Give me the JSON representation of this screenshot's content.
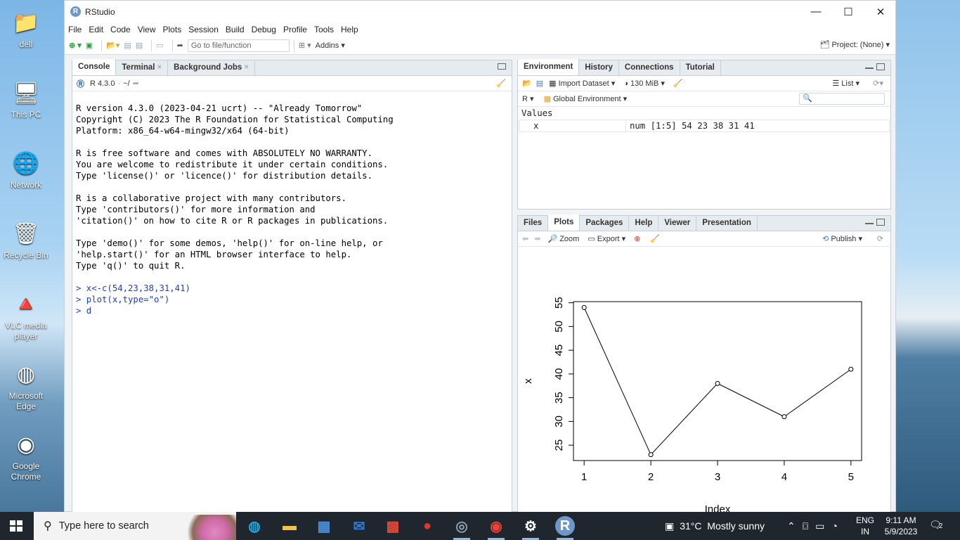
{
  "desktop": {
    "icons": [
      {
        "label": "dell",
        "icon": "user-folder-icon"
      },
      {
        "label": "This PC",
        "icon": "computer-icon"
      },
      {
        "label": "Network",
        "icon": "network-icon"
      },
      {
        "label": "Recycle Bin",
        "icon": "recycle-bin-icon"
      },
      {
        "label": "VLC media player",
        "icon": "vlc-icon"
      },
      {
        "label": "Microsoft Edge",
        "icon": "edge-icon"
      },
      {
        "label": "Google Chrome",
        "icon": "chrome-icon"
      }
    ]
  },
  "window": {
    "title": "RStudio",
    "controls": {
      "minimize": "—",
      "maximize": "☐",
      "close": "✕"
    }
  },
  "menu": [
    "File",
    "Edit",
    "Code",
    "View",
    "Plots",
    "Session",
    "Build",
    "Debug",
    "Profile",
    "Tools",
    "Help"
  ],
  "toolbar": {
    "goto_placeholder": "Go to file/function",
    "addins": "Addins",
    "project": "Project: (None)"
  },
  "console_pane": {
    "tabs": [
      {
        "label": "Console",
        "closable": false
      },
      {
        "label": "Terminal",
        "closable": true
      },
      {
        "label": "Background Jobs",
        "closable": true
      }
    ],
    "r_version": "R 4.3.0",
    "path": "~/",
    "output_lines": [
      "R version 4.3.0 (2023-04-21 ucrt) -- \"Already Tomorrow\"",
      "Copyright (C) 2023 The R Foundation for Statistical Computing",
      "Platform: x86_64-w64-mingw32/x64 (64-bit)",
      "",
      "R is free software and comes with ABSOLUTELY NO WARRANTY.",
      "You are welcome to redistribute it under certain conditions.",
      "Type 'license()' or 'licence()' for distribution details.",
      "",
      "R is a collaborative project with many contributors.",
      "Type 'contributors()' for more information and",
      "'citation()' on how to cite R or R packages in publications.",
      "",
      "Type 'demo()' for some demos, 'help()' for on-line help, or",
      "'help.start()' for an HTML browser interface to help.",
      "Type 'q()' to quit R.",
      ""
    ],
    "input_lines": [
      "> x<-c(54,23,38,31,41)",
      "> plot(x,type=\"o\")",
      "> d"
    ]
  },
  "env_pane": {
    "tabs": [
      "Environment",
      "History",
      "Connections",
      "Tutorial"
    ],
    "import_dataset": "Import Dataset",
    "memory": "130 MiB",
    "list_view": "List",
    "language": "R",
    "scope": "Global Environment",
    "section": "Values",
    "values": [
      {
        "name": "x",
        "value": "num [1:5] 54 23 38 31 41"
      }
    ]
  },
  "plots_pane": {
    "tabs": [
      "Files",
      "Plots",
      "Packages",
      "Help",
      "Viewer",
      "Presentation"
    ],
    "zoom": "Zoom",
    "export": "Export",
    "publish": "Publish"
  },
  "chart_data": {
    "type": "line",
    "markers": "open-circle",
    "x": [
      1,
      2,
      3,
      4,
      5
    ],
    "values": [
      54,
      23,
      38,
      31,
      41
    ],
    "xlabel": "Index",
    "ylabel": "x",
    "xticks": [
      "1",
      "2",
      "3",
      "4",
      "5"
    ],
    "yticks": [
      "25",
      "30",
      "35",
      "40",
      "45",
      "50",
      "55"
    ],
    "xlim": [
      0.84,
      5.16
    ],
    "ylim": [
      21.76,
      55.24
    ],
    "grid": false
  },
  "taskbar": {
    "search_placeholder": "Type here to search",
    "weather": "31°C  Mostly sunny",
    "language": "ENG",
    "region": "IN",
    "time": "9:11 AM",
    "date": "5/9/2023",
    "notifications": "2",
    "apps": [
      "edge-icon",
      "file-explorer-icon",
      "store-icon",
      "mail-icon",
      "game-icon",
      "angry-birds-icon",
      "browser-icon",
      "chrome-icon",
      "settings-icon",
      "rstudio-icon"
    ]
  }
}
